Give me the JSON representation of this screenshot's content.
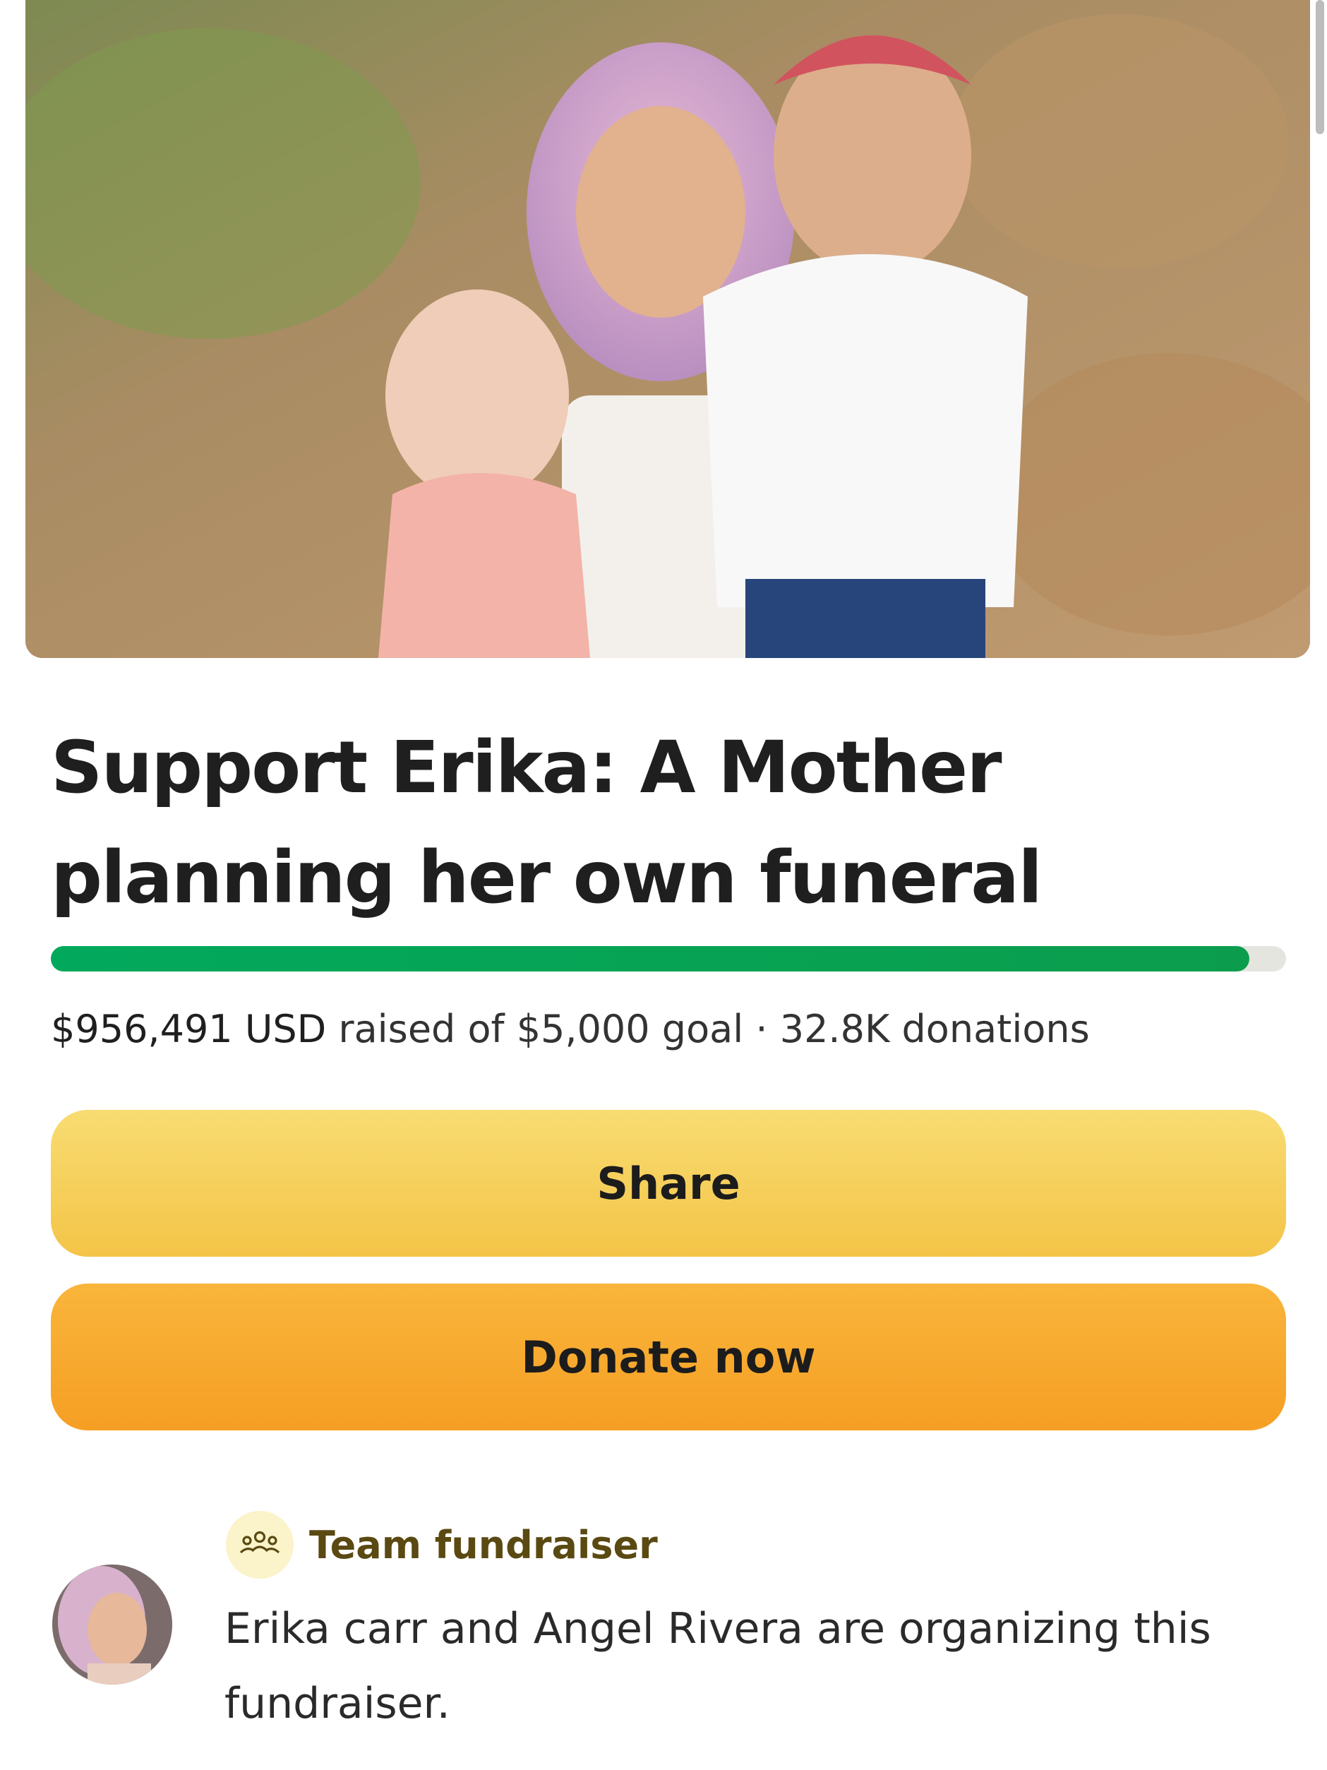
{
  "campaign": {
    "title": "Support Erika: A Mother planning her own funeral",
    "photo_icon": "family-photo",
    "raised_amount": "$956,491 USD",
    "raised_rest": "raised of $5,000 goal · 32.8K donations",
    "progress_fraction": 0.97
  },
  "actions": {
    "share_label": "Share",
    "donate_label": "Donate now"
  },
  "organizer": {
    "team_icon": "team-icon",
    "team_label": "Team fundraiser",
    "description": "Erika carr and Angel Rivera are organizing this fundraiser."
  },
  "colors": {
    "progress": "#02a95c",
    "share_button": "#f6cf5a",
    "donate_button": "#f7a82d",
    "team_label": "#5a4a12"
  }
}
